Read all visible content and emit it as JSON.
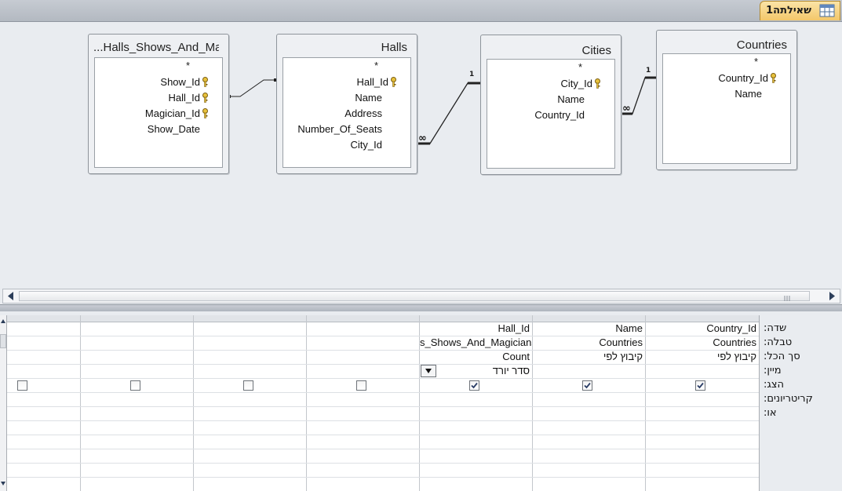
{
  "document_tab": {
    "label": "שאילתה1",
    "icon": "query-icon"
  },
  "tables": [
    {
      "title": "...Halls_Shows_And_Ma",
      "star": "*",
      "fields": [
        "Show_Id",
        "Hall_Id",
        "Magician_Id",
        "Show_Date"
      ],
      "key_fields": [
        "Show_Id",
        "Hall_Id",
        "Magician_Id"
      ]
    },
    {
      "title": "Halls",
      "star": "*",
      "fields": [
        "Hall_Id",
        "Name",
        "Address",
        "Number_Of_Seats",
        "City_Id"
      ],
      "key_fields": [
        "Hall_Id"
      ]
    },
    {
      "title": "Cities",
      "star": "*",
      "fields": [
        "City_Id",
        "Name",
        "Country_Id"
      ],
      "key_fields": [
        "City_Id"
      ]
    },
    {
      "title": "Countries",
      "star": "*",
      "fields": [
        "Country_Id",
        "Name"
      ],
      "key_fields": [
        "Country_Id"
      ]
    }
  ],
  "relationships": [
    {
      "from": "Halls_Shows_And_Magicians.Hall_Id",
      "to": "Halls.Hall_Id"
    },
    {
      "from": "Halls.City_Id",
      "to": "Cities.City_Id",
      "many_label": "∞",
      "one_label": "1"
    },
    {
      "from": "Cities.Country_Id",
      "to": "Countries.Country_Id",
      "many_label": "∞",
      "one_label": "1"
    }
  ],
  "grid": {
    "row_labels": [
      "שדה:",
      "טבלה:",
      "סך הכל:",
      "מיין:",
      "הצג:",
      "קריטריונים:",
      "או:"
    ],
    "columns": [
      {
        "field": "Country_Id",
        "table": "Countries",
        "total": "קיבוץ לפי",
        "sort": "",
        "show": true
      },
      {
        "field": "Name",
        "table": "Countries",
        "total": "קיבוץ לפי",
        "sort": "",
        "show": true
      },
      {
        "field": "Hall_Id",
        "table": "s_Shows_And_Magicians",
        "total": "Count",
        "sort": "סדר יורד",
        "show": true
      },
      {
        "field": "",
        "table": "",
        "total": "",
        "sort": "",
        "show": false
      },
      {
        "field": "",
        "table": "",
        "total": "",
        "sort": "",
        "show": false
      },
      {
        "field": "",
        "table": "",
        "total": "",
        "sort": "",
        "show": false
      },
      {
        "field": "",
        "table": "",
        "total": "",
        "sort": "",
        "show": false
      }
    ]
  },
  "colors": {
    "tab_accent": "#f3c76a",
    "title_bar": "#b3b9c1"
  }
}
